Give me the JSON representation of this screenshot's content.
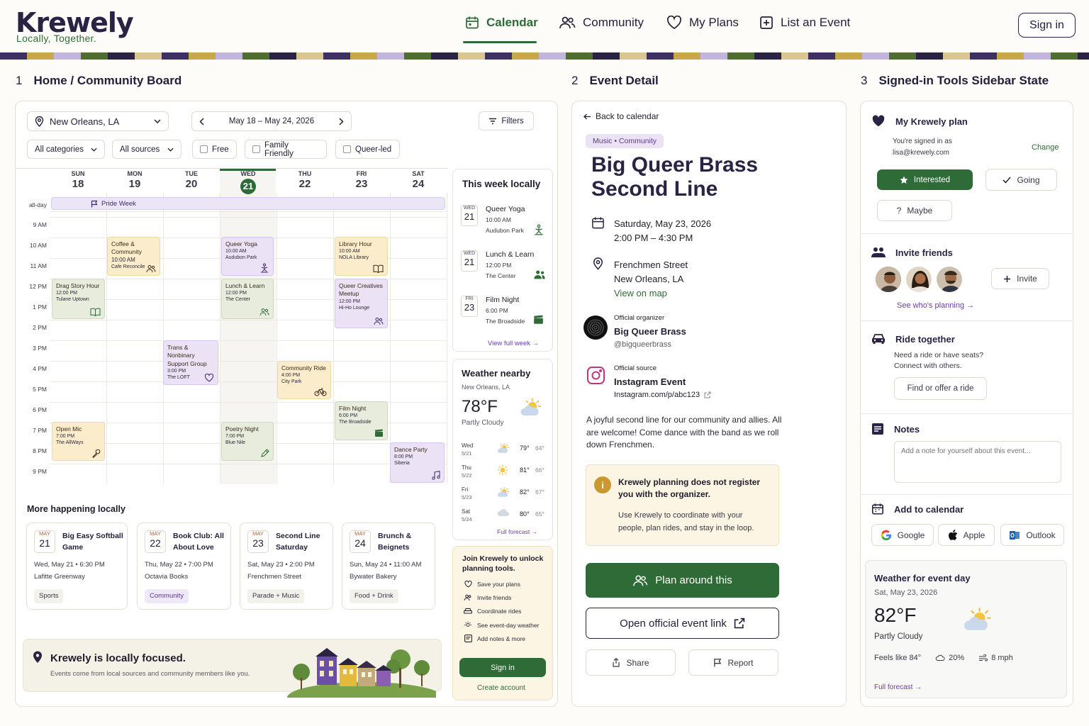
{
  "brand": {
    "name": "Krewely",
    "tagline": "Locally, Together."
  },
  "nav": {
    "calendar": "Calendar",
    "community": "Community",
    "my_plans": "My Plans",
    "list_event": "List an Event",
    "sign_in": "Sign in"
  },
  "sections": {
    "s1": {
      "num": "1",
      "title": "Home / Community Board"
    },
    "s2": {
      "num": "2",
      "title": "Event Detail"
    },
    "s3": {
      "num": "3",
      "title": "Signed-in Tools Sidebar State"
    }
  },
  "board": {
    "location": "New Orleans, LA",
    "date_range": "May 18 – May 24, 2026",
    "filters": "Filters",
    "categories": "All categories",
    "sources": "All sources",
    "free": "Free",
    "family": "Family Friendly",
    "queer": "Queer-led",
    "days": [
      {
        "dow": "SUN",
        "num": "18"
      },
      {
        "dow": "MON",
        "num": "19"
      },
      {
        "dow": "TUE",
        "num": "20"
      },
      {
        "dow": "WED",
        "num": "21"
      },
      {
        "dow": "THU",
        "num": "22"
      },
      {
        "dow": "FRI",
        "num": "23"
      },
      {
        "dow": "SAT",
        "num": "24"
      }
    ],
    "allday": "all-day",
    "pride_week": "Pride Week",
    "hours": [
      "9 AM",
      "10 AM",
      "11 AM",
      "12 PM",
      "1 PM",
      "2 PM",
      "3 PM",
      "4 PM",
      "5 PM",
      "6 PM",
      "7 PM",
      "8 PM",
      "9 PM"
    ],
    "events": {
      "coffee": {
        "title": "Coffee & Community",
        "time": "10:00 AM",
        "place": "Cafe Reconcile"
      },
      "yoga": {
        "title": "Queer Yoga",
        "time": "10:00 AM",
        "place": "Audubon Park"
      },
      "library": {
        "title": "Library Hour",
        "time": "10:00 AM",
        "place": "NOLA Library"
      },
      "drag": {
        "title": "Drag Story Hour",
        "time": "12:00 PM",
        "place": "Tulane Uptown"
      },
      "lunch": {
        "title": "Lunch & Learn",
        "time": "12:00 PM",
        "place": "The Center"
      },
      "creatives": {
        "title": "Queer Creatives Meetup",
        "time": "12:00 PM",
        "place": "Hi-Ho Lounge"
      },
      "trans": {
        "title": "Trans & Nonbinary Support Group",
        "time": "3:00 PM",
        "place": "The LOFT"
      },
      "ride": {
        "title": "Community Ride",
        "time": "4:00 PM",
        "place": "City Park"
      },
      "film": {
        "title": "Film Night",
        "time": "6:00 PM",
        "place": "The Broadside"
      },
      "openmic": {
        "title": "Open Mic",
        "time": "7:00 PM",
        "place": "The AllWays"
      },
      "poetry": {
        "title": "Poetry Night",
        "time": "7:00 PM",
        "place": "Blue Nile"
      },
      "dance": {
        "title": "Dance Party",
        "time": "8:00 PM",
        "place": "Siberia"
      }
    },
    "week": {
      "title": "This week locally",
      "items": [
        {
          "dow": "WED",
          "num": "21",
          "title": "Queer Yoga",
          "time": "10:00 AM",
          "place": "Audubon Park"
        },
        {
          "dow": "WED",
          "num": "21",
          "title": "Lunch & Learn",
          "time": "12:00 PM",
          "place": "The Center"
        },
        {
          "dow": "FRI",
          "num": "23",
          "title": "Film Night",
          "time": "6:00 PM",
          "place": "The Broadside"
        }
      ],
      "view_full": "View full week →"
    },
    "weather": {
      "title": "Weather nearby",
      "location": "New Orleans, LA",
      "temp": "78°F",
      "cond": "Partly Cloudy",
      "days": [
        {
          "d": "Wed",
          "date": "5/21",
          "hi": "79°",
          "lo": "64°"
        },
        {
          "d": "Thu",
          "date": "5/22",
          "hi": "81°",
          "lo": "66°"
        },
        {
          "d": "Fri",
          "date": "5/23",
          "hi": "82°",
          "lo": "67°"
        },
        {
          "d": "Sat",
          "date": "5/24",
          "hi": "80°",
          "lo": "65°"
        }
      ],
      "full": "Full forecast →"
    },
    "join": {
      "title": "Join Krewely to unlock planning tools.",
      "items": [
        "Save your plans",
        "Invite friends",
        "Coordinate rides",
        "See event-day weather",
        "Add notes & more"
      ],
      "sign_in": "Sign in",
      "create": "Create account"
    },
    "more": {
      "title": "More happening locally",
      "cards": [
        {
          "mon": "MAY",
          "num": "21",
          "title": "Big Easy Softball Game",
          "when": "Wed, May 21 • 6:30 PM",
          "where": "Lafitte Greenway",
          "tag": "Sports"
        },
        {
          "mon": "MAY",
          "num": "22",
          "title": "Book Club: All About Love",
          "when": "Thu, May 22 • 7:00 PM",
          "where": "Octavia Books",
          "tag": "Community"
        },
        {
          "mon": "MAY",
          "num": "23",
          "title": "Second Line Saturday",
          "when": "Sat, May 23 • 2:00 PM",
          "where": "Frenchmen Street",
          "tag": "Parade + Music"
        },
        {
          "mon": "MAY",
          "num": "24",
          "title": "Brunch & Beignets",
          "when": "Sun, May 24 • 11:00 AM",
          "where": "Bywater Bakery",
          "tag": "Food + Drink"
        }
      ]
    },
    "focus": {
      "title": "Krewely is locally focused.",
      "body": "Events come from local sources and community members like you."
    }
  },
  "detail": {
    "back": "Back to calendar",
    "tag": "Music • Community",
    "title_l1": "Big Queer Brass",
    "title_l2": "Second Line",
    "date": "Saturday, May 23, 2026",
    "time": "2:00 PM – 4:30 PM",
    "place1": "Frenchmen Street",
    "place2": "New Orleans, LA",
    "map": "View on map",
    "org_label": "Official organizer",
    "org_name": "Big Queer Brass",
    "org_handle": "@bigqueerbrass",
    "src_label": "Official source",
    "src_name": "Instagram Event",
    "src_link": "Instagram.com/p/abc123",
    "desc": "A joyful second line for our community and allies. All are welcome! Come dance with the band as we roll down Frenchmen.",
    "notice_title": "Krewely planning does not register you with the organizer.",
    "notice_body": "Use Krewely to coordinate with your people, plan rides, and stay in the loop.",
    "plan": "Plan around this",
    "official": "Open official event link",
    "share": "Share",
    "report": "Report"
  },
  "sidebar": {
    "plan_title": "My Krewely plan",
    "signed_as": "You're signed in as",
    "email": "lisa@krewely.com",
    "change": "Change",
    "interested": "Interested",
    "going": "Going",
    "maybe": "Maybe",
    "invite_title": "Invite friends",
    "invite_btn": "Invite",
    "whos": "See who's planning →",
    "ride_title": "Ride together",
    "ride_body": "Need a ride or have seats? Connect with others.",
    "ride_btn": "Find or offer a ride",
    "notes_title": "Notes",
    "notes_placeholder": "Add a note for yourself about this event...",
    "cal_title": "Add to calendar",
    "google": "Google",
    "apple": "Apple",
    "outlook": "Outlook",
    "w_title": "Weather for event day",
    "w_date": "Sat, May 23, 2026",
    "w_temp": "82°F",
    "w_cond": "Partly Cloudy",
    "w_feels": "Feels like 84°",
    "w_rain": "20%",
    "w_wind": "8 mph",
    "w_full": "Full forecast →"
  },
  "colors": {
    "brand_green": "#2e6b36",
    "brand_navy": "#2a2344",
    "lavender": "#ebe2f6",
    "butter": "#fbeccc",
    "sage": "#e7ecdc"
  }
}
